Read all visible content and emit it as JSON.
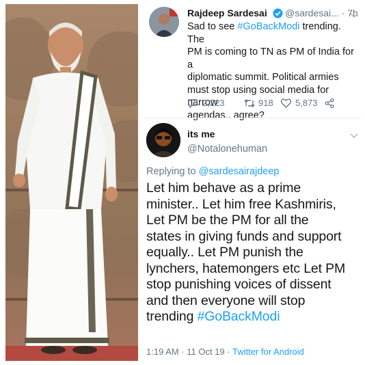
{
  "parent_tweet": {
    "author_name": "Rajdeep Sardesai",
    "handle_time": "@sardesai... · 7h",
    "text_prefix": "Sad to see ",
    "hashtag": "#GoBackModi",
    "text_line1_suffix": " trending. The",
    "text_line2": "PM is coming to TN as PM of India for a",
    "text_line3": "diplomatic summit. Political armies",
    "text_line4": "must stop using social media for narrow",
    "text_line5": "agendas.. agree?",
    "replies": "2,223",
    "retweets": "918",
    "likes": "5,873"
  },
  "reply_tweet": {
    "author_name": "its me",
    "handle": "@Notalonehuman",
    "replying_prefix": "Replying to ",
    "replying_to": "@sardesairajdeep",
    "lines": [
      "Let him behave as a prime",
      "minister.. Let him free Kashmiris,",
      "Let PM be the PM for all the",
      "states in giving funds and support",
      "equally.. Let PM punish the",
      "lynchers, hatemongers etc Let PM",
      "stop punishing voices of dissent",
      "and then everyone will stop"
    ],
    "last_line_prefix": "trending ",
    "last_line_hashtag": "#GoBackModi",
    "timestamp": "1:19 AM · 11 Oct 19 · ",
    "client": "Twitter for Android"
  },
  "colors": {
    "link": "#1da1f2",
    "muted": "#657786",
    "text": "#14171a"
  },
  "icons": [
    "verified-badge-icon",
    "chevron-down-icon",
    "reply-icon",
    "retweet-icon",
    "like-icon",
    "share-icon"
  ]
}
